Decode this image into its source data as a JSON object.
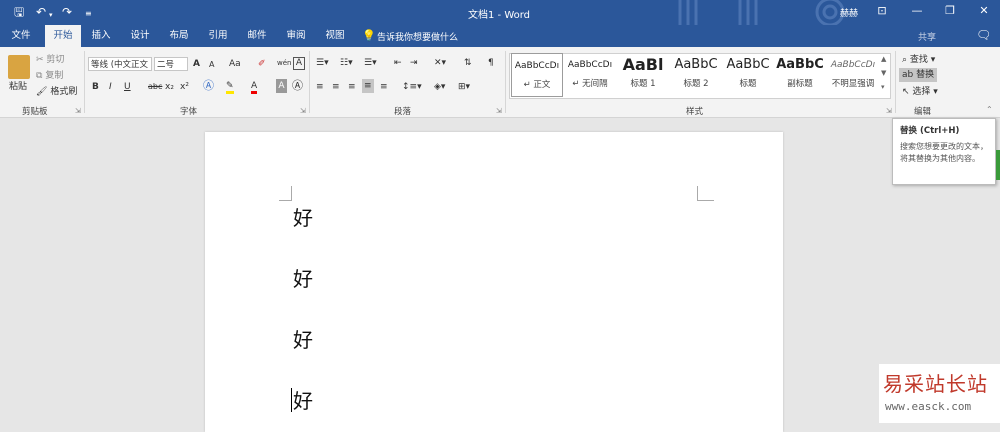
{
  "app": {
    "doc_title": "文档1 - Word",
    "user": "赫赫"
  },
  "tabs": [
    "文件",
    "开始",
    "插入",
    "设计",
    "布局",
    "引用",
    "邮件",
    "审阅",
    "视图"
  ],
  "tell_me": "告诉我你想要做什么",
  "share": "共享",
  "clipboard": {
    "paste": "粘贴",
    "cut": "剪切",
    "copy": "复制",
    "format_painter": "格式刷",
    "label": "剪贴板"
  },
  "font": {
    "name": "等线 (中文正文",
    "size": "二号",
    "label": "字体",
    "grow": "A",
    "shrink": "A",
    "case": "Aa",
    "wen": "wén",
    "bold": "B",
    "italic": "I",
    "underline": "U",
    "strike": "abc",
    "sub": "x₂",
    "sup": "x²"
  },
  "paragraph": {
    "label": "段落"
  },
  "styles": {
    "label": "样式",
    "items": [
      {
        "sample": "AaBbCcDı",
        "name": "↵ 正文"
      },
      {
        "sample": "AaBbCcDı",
        "name": "↵ 无间隔"
      },
      {
        "sample": "AaBl",
        "name": "标题 1"
      },
      {
        "sample": "AaBbC",
        "name": "标题 2"
      },
      {
        "sample": "AaBbC",
        "name": "标题"
      },
      {
        "sample": "AaBbC",
        "name": "副标题"
      },
      {
        "sample": "AaBbCcDı",
        "name": "不明显强调"
      }
    ]
  },
  "editing": {
    "find": "查找",
    "replace": "替换",
    "select": "选择",
    "label": "编辑"
  },
  "tooltip": {
    "title": "替换 (Ctrl+H)",
    "body": "搜索您想要更改的文本，将其替换为其他内容。"
  },
  "document": {
    "paragraphs": [
      "好",
      "好",
      "好",
      "好"
    ]
  },
  "watermark": {
    "title": "易采站长站",
    "url": "www.easck.com"
  }
}
